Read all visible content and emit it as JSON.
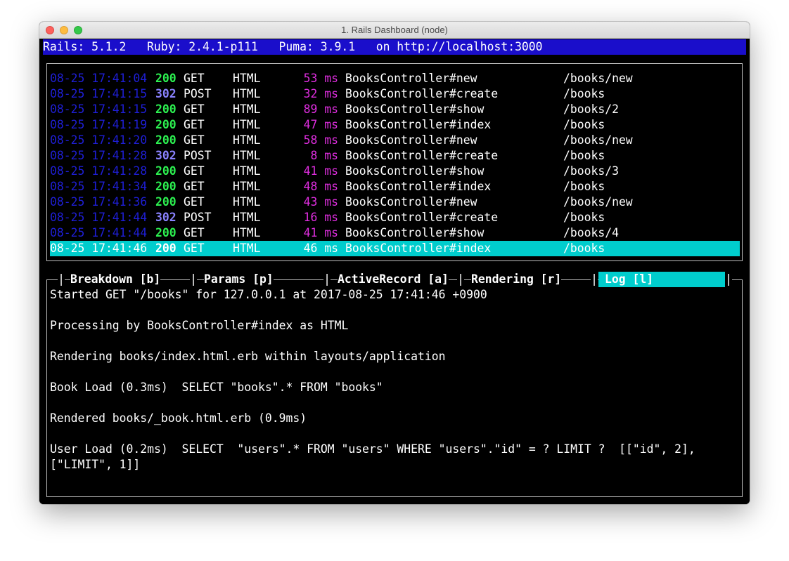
{
  "window": {
    "title": "1. Rails Dashboard (node)"
  },
  "status_bar": {
    "rails": "Rails: 5.1.2",
    "ruby": "Ruby: 2.4.1-p111",
    "puma": "Puma: 3.9.1",
    "url": "on http://localhost:3000"
  },
  "requests": [
    {
      "time": "08-25 17:41:04",
      "status": "200",
      "method": "GET",
      "format": "HTML",
      "duration": "53 ms",
      "action": "BooksController#new",
      "path": "/books/new"
    },
    {
      "time": "08-25 17:41:15",
      "status": "302",
      "method": "POST",
      "format": "HTML",
      "duration": "32 ms",
      "action": "BooksController#create",
      "path": "/books"
    },
    {
      "time": "08-25 17:41:15",
      "status": "200",
      "method": "GET",
      "format": "HTML",
      "duration": "89 ms",
      "action": "BooksController#show",
      "path": "/books/2"
    },
    {
      "time": "08-25 17:41:19",
      "status": "200",
      "method": "GET",
      "format": "HTML",
      "duration": "47 ms",
      "action": "BooksController#index",
      "path": "/books"
    },
    {
      "time": "08-25 17:41:20",
      "status": "200",
      "method": "GET",
      "format": "HTML",
      "duration": "58 ms",
      "action": "BooksController#new",
      "path": "/books/new"
    },
    {
      "time": "08-25 17:41:28",
      "status": "302",
      "method": "POST",
      "format": "HTML",
      "duration": "8 ms",
      "action": "BooksController#create",
      "path": "/books"
    },
    {
      "time": "08-25 17:41:28",
      "status": "200",
      "method": "GET",
      "format": "HTML",
      "duration": "41 ms",
      "action": "BooksController#show",
      "path": "/books/3"
    },
    {
      "time": "08-25 17:41:34",
      "status": "200",
      "method": "GET",
      "format": "HTML",
      "duration": "48 ms",
      "action": "BooksController#index",
      "path": "/books"
    },
    {
      "time": "08-25 17:41:36",
      "status": "200",
      "method": "GET",
      "format": "HTML",
      "duration": "43 ms",
      "action": "BooksController#new",
      "path": "/books/new"
    },
    {
      "time": "08-25 17:41:44",
      "status": "302",
      "method": "POST",
      "format": "HTML",
      "duration": "16 ms",
      "action": "BooksController#create",
      "path": "/books"
    },
    {
      "time": "08-25 17:41:44",
      "status": "200",
      "method": "GET",
      "format": "HTML",
      "duration": "41 ms",
      "action": "BooksController#show",
      "path": "/books/4"
    },
    {
      "time": "08-25 17:41:46",
      "status": "200",
      "method": "GET",
      "format": "HTML",
      "duration": "46 ms",
      "action": "BooksController#index",
      "path": "/books",
      "selected": true
    }
  ],
  "tabs": [
    {
      "label": "Breakdown [b]"
    },
    {
      "label": "Params [p]"
    },
    {
      "label": "ActiveRecord [a]"
    },
    {
      "label": "Rendering [r]"
    },
    {
      "label": "Log [l]",
      "active": true
    }
  ],
  "tab_separator": "|",
  "log_lines": [
    "Started GET \"/books\" for 127.0.0.1 at 2017-08-25 17:41:46 +0900",
    "",
    "Processing by BooksController#index as HTML",
    "",
    "Rendering books/index.html.erb within layouts/application",
    "",
    "Book Load (0.3ms)  SELECT \"books\".* FROM \"books\"",
    "",
    "Rendered books/_book.html.erb (0.9ms)",
    "",
    "User Load (0.2ms)  SELECT  \"users\".* FROM \"users\" WHERE \"users\".\"id\" = ? LIMIT ?  [[\"id\", 2],",
    "[\"LIMIT\", 1]]"
  ],
  "colors": {
    "status_bar_bg": "#1a0ecb",
    "timestamp": "#1f1fd8",
    "status_200": "#2cf050",
    "status_302": "#8a82ff",
    "duration": "#e12ee1",
    "selection": "#00cdcd"
  }
}
